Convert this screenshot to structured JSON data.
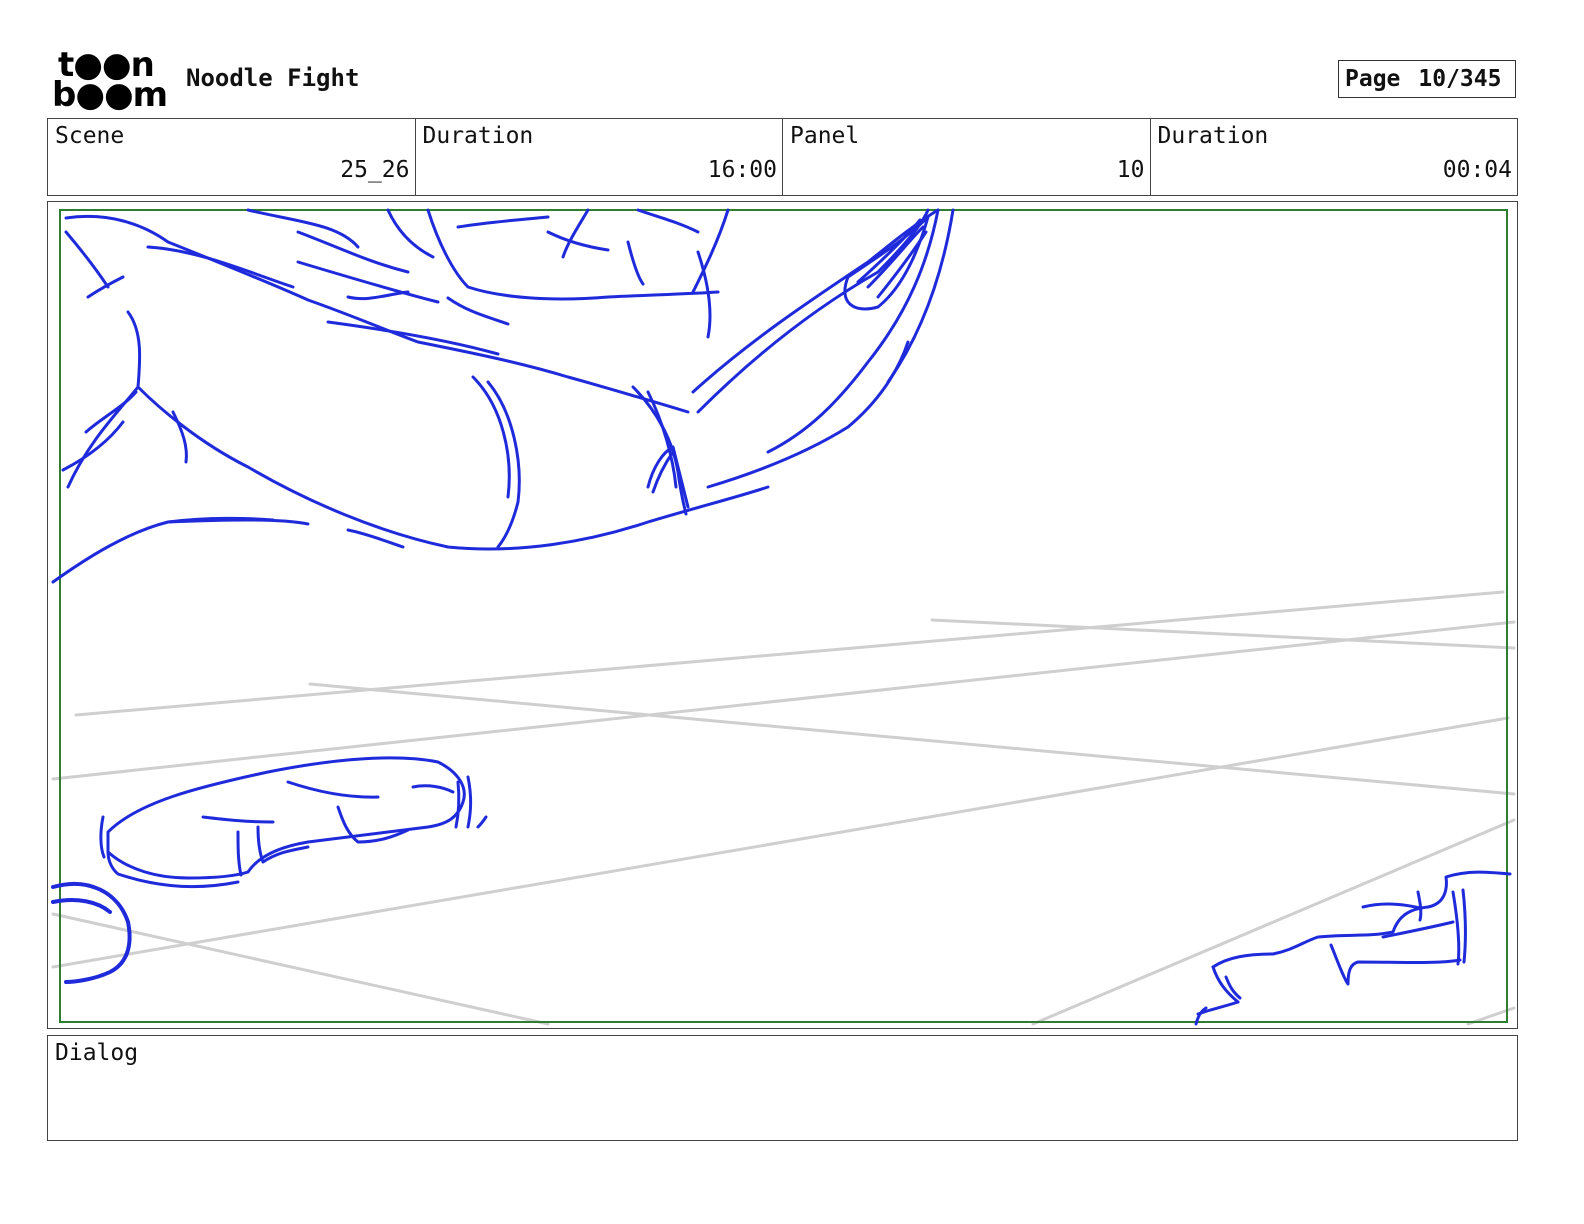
{
  "logo": {
    "line1": "t●●n",
    "line2": "b●●m"
  },
  "title": "Noodle Fight",
  "page": {
    "label": "Page",
    "value": "10/345"
  },
  "info": [
    {
      "label": "Scene",
      "value": "25_26"
    },
    {
      "label": "Duration",
      "value": "16:00"
    },
    {
      "label": "Panel",
      "value": "10"
    },
    {
      "label": "Duration",
      "value": "00:04"
    }
  ],
  "dialog": {
    "label": "Dialog",
    "text": ""
  },
  "colors": {
    "sketch": "#1f2bdb",
    "guides": "#cfcfcf",
    "safe_frame": "#2e7d32",
    "border": "#444444"
  }
}
